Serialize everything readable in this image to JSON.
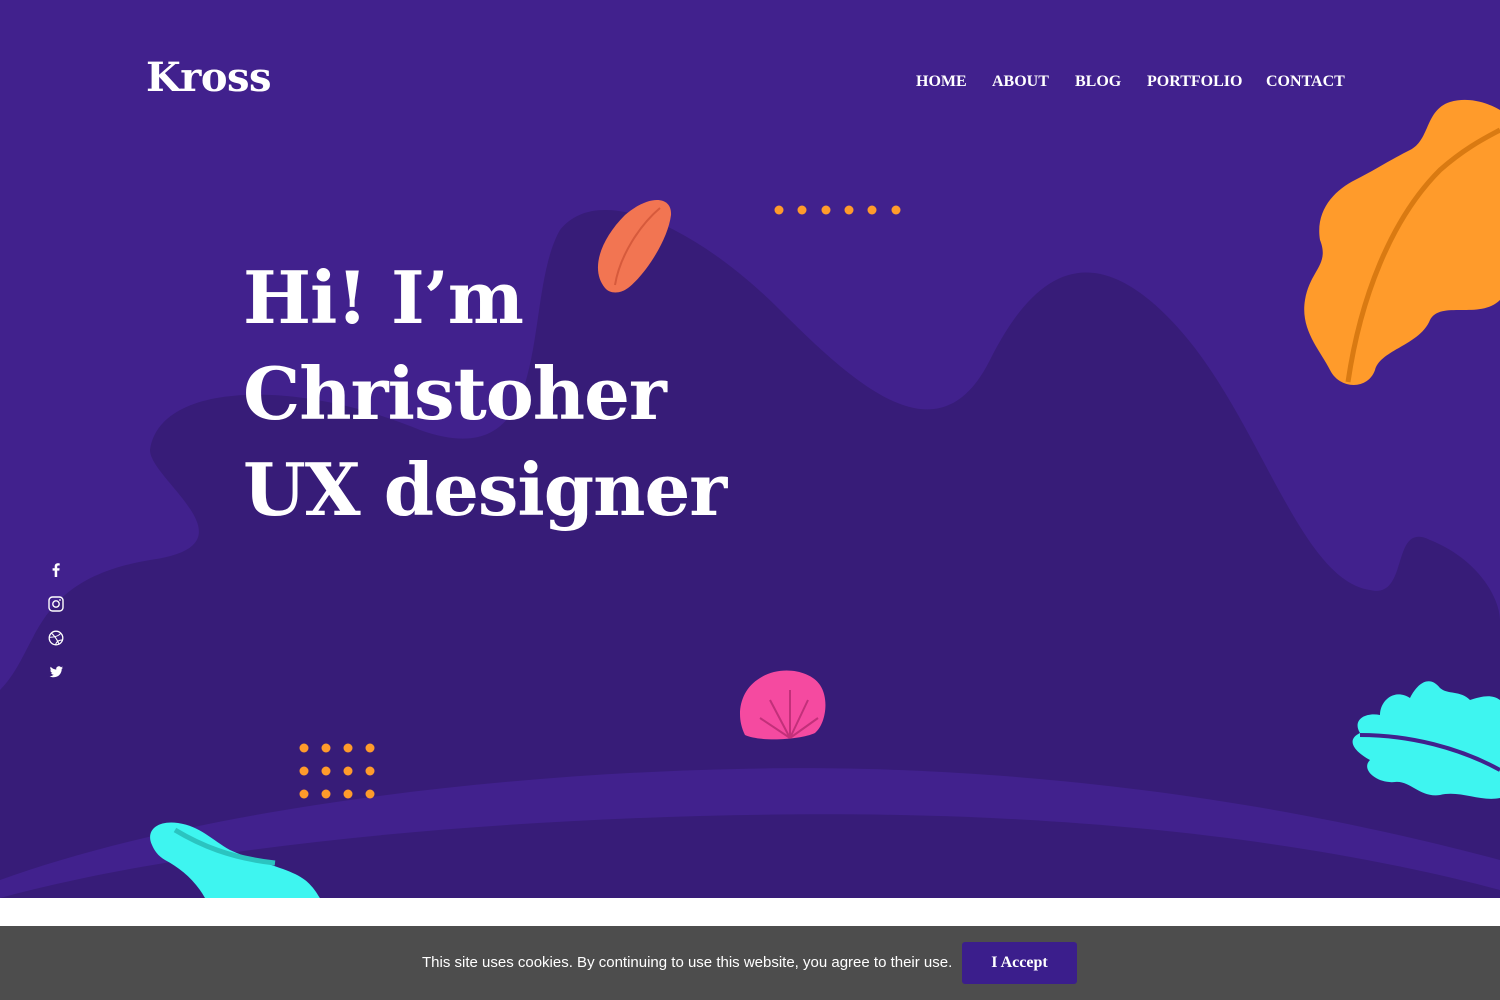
{
  "brand": {
    "logo_text": "Kross"
  },
  "nav": {
    "items": [
      {
        "label": "HOME"
      },
      {
        "label": "ABOUT"
      },
      {
        "label": "BLOG"
      },
      {
        "label": "PORTFOLIO"
      },
      {
        "label": "CONTACT"
      }
    ]
  },
  "hero": {
    "title_lines": [
      "Hi! I’m",
      "Christoher",
      "UX designer"
    ]
  },
  "social": {
    "icons": [
      "facebook-icon",
      "instagram-icon",
      "dribbble-icon",
      "twitter-icon"
    ]
  },
  "cookie": {
    "message": "This site uses cookies. By continuing to use this website, you agree to their use.",
    "accept_label": "I Accept"
  },
  "colors": {
    "hero_background": "#41218d",
    "blob": "#371c78",
    "accent_orange": "#ff9b2b",
    "accent_coral": "#f27552",
    "accent_cyan": "#3ef5f0",
    "accent_pink": "#f54aa0",
    "cookie_bar": "#4d4d4d",
    "cookie_button": "#3b1e8c"
  }
}
